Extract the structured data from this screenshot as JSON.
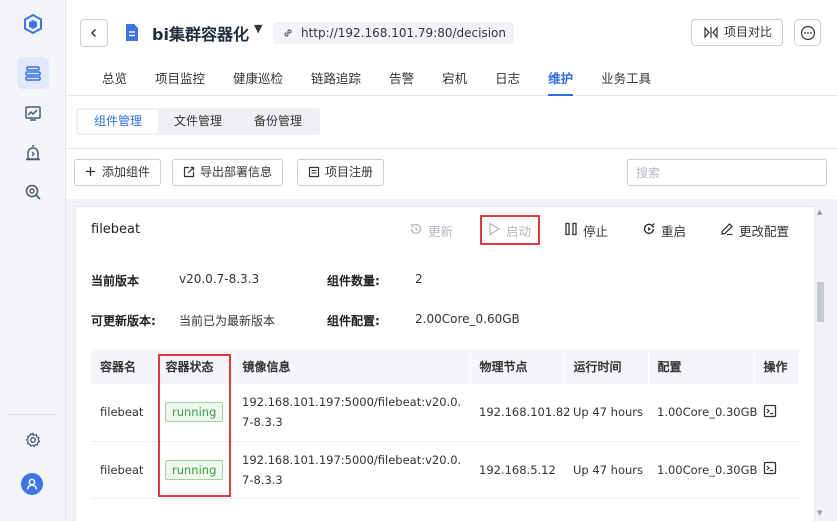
{
  "header": {
    "title": "bi集群容器化",
    "url": "http://192.168.101.79:80/decision",
    "compare_label": "项目对比"
  },
  "nav": {
    "tabs": [
      "总览",
      "项目监控",
      "健康巡检",
      "链路追踪",
      "告警",
      "宕机",
      "日志",
      "维护",
      "业务工具"
    ],
    "active": "维护"
  },
  "subtabs": {
    "items": [
      "组件管理",
      "文件管理",
      "备份管理"
    ],
    "active": "组件管理"
  },
  "toolbar": {
    "add_label": "添加组件",
    "export_label": "导出部署信息",
    "register_label": "项目注册",
    "search_placeholder": "搜索"
  },
  "component": {
    "name": "filebeat",
    "actions": {
      "update": "更新",
      "start": "启动",
      "stop": "停止",
      "restart": "重启",
      "config": "更改配置"
    },
    "current_version_label": "当前版本",
    "current_version": "v20.0.7-8.3.3",
    "count_label": "组件数量:",
    "count": "2",
    "updatable_label": "可更新版本:",
    "updatable": "当前已为最新版本",
    "config_label": "组件配置:",
    "config": "2.00Core_0.60GB"
  },
  "table": {
    "headers": [
      "容器名",
      "容器状态",
      "镜像信息",
      "物理节点",
      "运行时间",
      "配置",
      "操作"
    ],
    "rows": [
      {
        "name": "filebeat",
        "status": "running",
        "image": "192.168.101.197:5000/filebeat:v20.0.7-8.3.3",
        "node": "192.168.101.82",
        "uptime": "Up 47 hours",
        "config": "1.00Core_0.30GB"
      },
      {
        "name": "filebeat",
        "status": "running",
        "image": "192.168.101.197:5000/filebeat:v20.0.7-8.3.3",
        "node": "192.168.5.12",
        "uptime": "Up 47 hours",
        "config": "1.00Core_0.30GB"
      }
    ]
  },
  "colors": {
    "accent": "#2f6fe4",
    "running": "#3c9d43",
    "highlight_box": "#e0393e"
  },
  "icons": {
    "rail": [
      "logo-cube-icon",
      "layers-icon",
      "monitor-chart-icon",
      "alarm-icon",
      "search-gear-icon"
    ],
    "rail_bottom": [
      "settings-icon",
      "user-avatar-icon"
    ]
  }
}
